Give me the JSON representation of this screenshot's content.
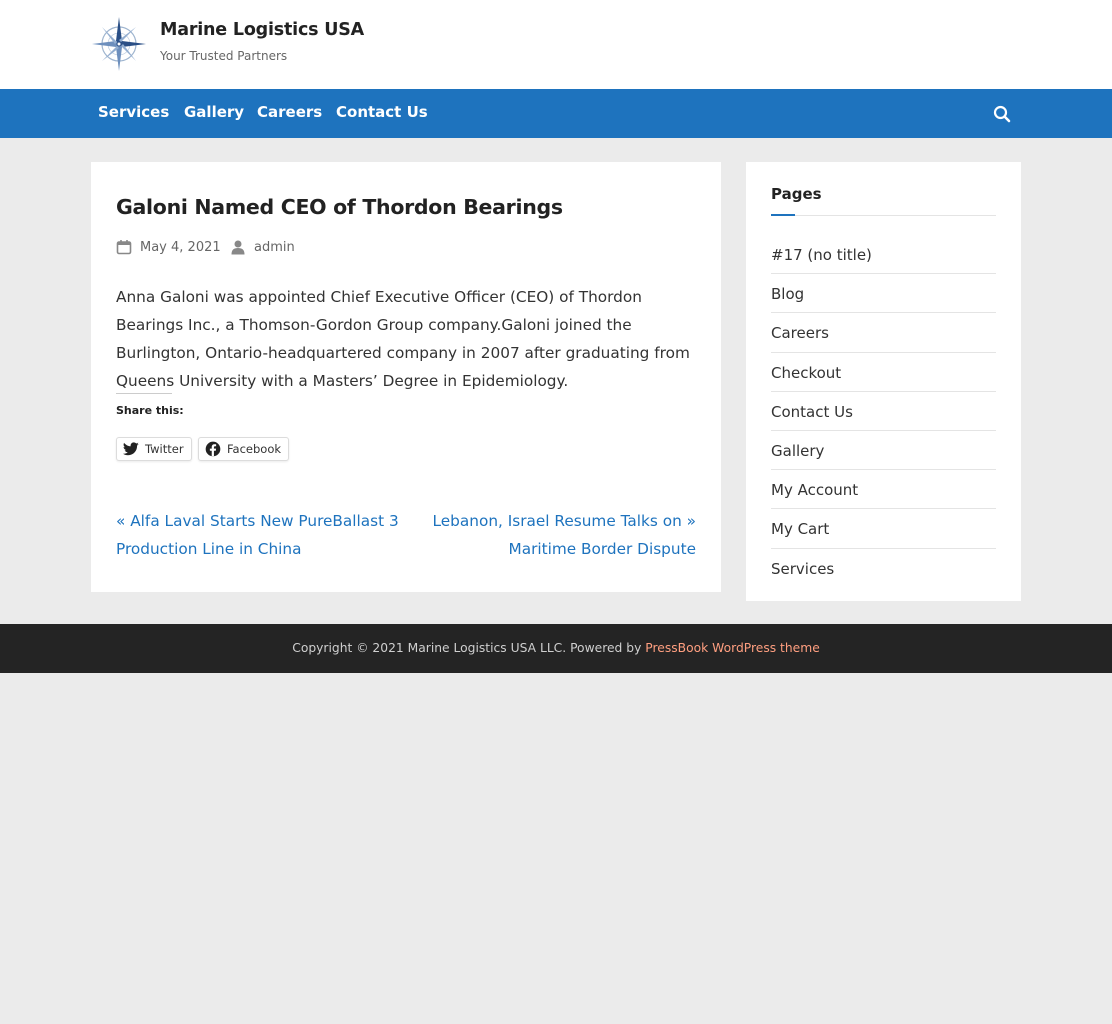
{
  "header": {
    "site_title": "Marine Logistics USA",
    "tagline": "Your Trusted Partners",
    "logo_icon": "compass-rose-logo"
  },
  "nav": {
    "items": [
      {
        "label": "Services"
      },
      {
        "label": "Gallery"
      },
      {
        "label": "Careers"
      },
      {
        "label": "Contact Us"
      }
    ],
    "search_icon": "search-icon",
    "bar_color": "#1e73be"
  },
  "post": {
    "title": "Galoni Named CEO of Thordon Bearings",
    "posted_on_icon": "calendar-icon",
    "date": "May 4, 2021",
    "author_icon": "user-icon",
    "author": "admin",
    "body": "Anna Galoni was appointed Chief Executive Officer (CEO) of Thordon Bearings Inc., a Thomson-Gordon Group company.Galoni joined the Burlington, Ontario-headquartered company in 2007 after graduating from Queens University with a Masters’ Degree in Epidemiology.",
    "share_label": "Share this:",
    "share_buttons": [
      {
        "label": "Twitter",
        "icon": "twitter-icon"
      },
      {
        "label": "Facebook",
        "icon": "facebook-icon"
      }
    ],
    "prev_label": "« Alfa Laval Starts New PureBallast 3 Production Line in China",
    "next_label": "Lebanon, Israel Resume Talks on » Maritime Border Dispute"
  },
  "sidebar": {
    "widget_title": "Pages",
    "pages": [
      "#17 (no title)",
      "Blog",
      "Careers",
      "Checkout",
      "Contact Us",
      "Gallery",
      "My Account",
      "My Cart",
      "Services"
    ]
  },
  "footer": {
    "copyright": "Copyright © 2021 Marine Logistics USA LLC. Powered by",
    "theme_link": "PressBook WordPress theme",
    "link_color": "#ff9f80"
  }
}
